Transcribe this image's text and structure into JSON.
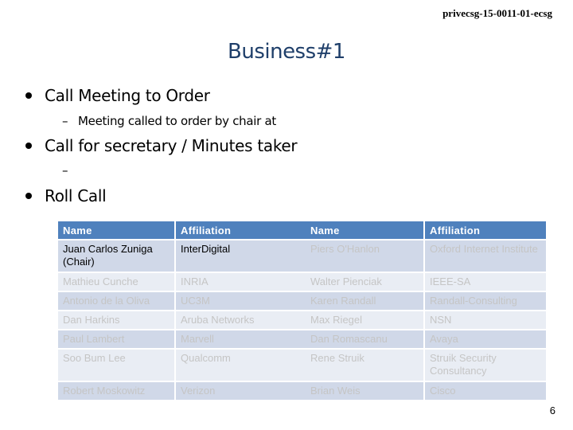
{
  "header": {
    "doc_id": "privecsg-15-0011-01-ecsg"
  },
  "slide": {
    "title": "Business#1",
    "bullets": [
      {
        "text": "Call Meeting to Order",
        "sub": "Meeting called to order by chair at"
      },
      {
        "text": "Call for secretary / Minutes taker",
        "sub": ""
      },
      {
        "text": "Roll Call"
      }
    ],
    "sub_dash": "–",
    "page_number": "6"
  },
  "roll_call": {
    "columns": [
      "Name",
      "Affiliation"
    ],
    "left": [
      {
        "name": "Juan Carlos Zuniga (Chair)",
        "affiliation": "InterDigital"
      },
      {
        "name": "Mathieu Cunche",
        "affiliation": "INRIA"
      },
      {
        "name": "Antonio de la Oliva",
        "affiliation": "UC3M"
      },
      {
        "name": "Dan Harkins",
        "affiliation": "Aruba Networks"
      },
      {
        "name": "Paul Lambert",
        "affiliation": "Marvell"
      },
      {
        "name": "Soo Bum Lee",
        "affiliation": "Qualcomm"
      },
      {
        "name": "Robert Moskowitz",
        "affiliation": "Verizon"
      }
    ],
    "right": [
      {
        "name": "Piers O'Hanlon",
        "affiliation": "Oxford Internet Institute"
      },
      {
        "name": "Walter Pienciak",
        "affiliation": "IEEE-SA"
      },
      {
        "name": "Karen Randall",
        "affiliation": "Randall-Consulting"
      },
      {
        "name": "Max Riegel",
        "affiliation": "NSN"
      },
      {
        "name": "Dan Romascanu",
        "affiliation": "Avaya"
      },
      {
        "name": "Rene Struik",
        "affiliation": "Struik Security Consultancy"
      },
      {
        "name": "Brian Weis",
        "affiliation": "Cisco"
      }
    ]
  },
  "colors": {
    "title": "#1f3f6a",
    "header_fill": "#4f81bd",
    "row_dark": "#d0d8e8",
    "row_light": "#e9edf4",
    "faded_text": "#c5c5c5"
  }
}
